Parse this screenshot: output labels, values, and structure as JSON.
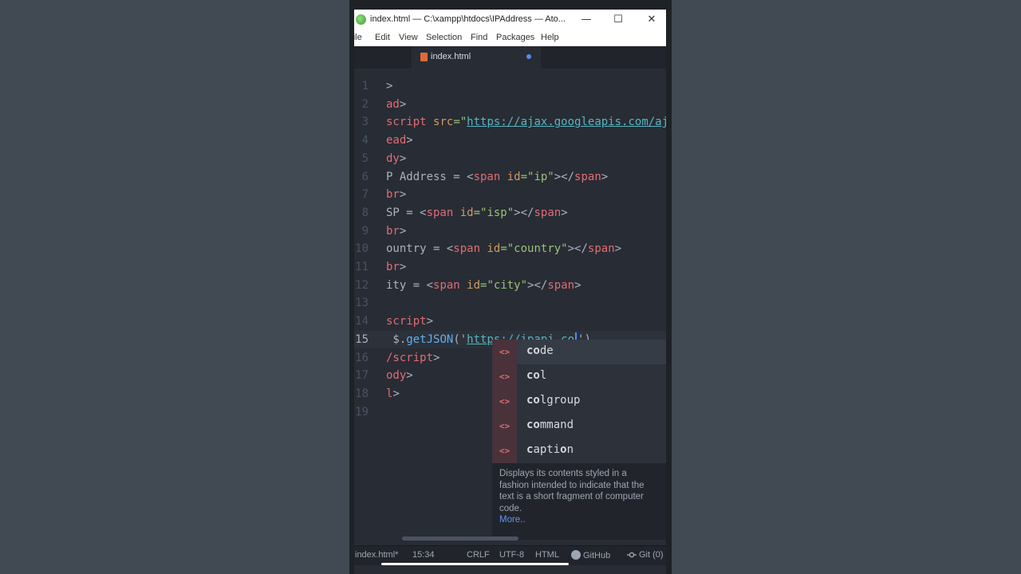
{
  "window": {
    "title": "index.html — C:\\xampp\\htdocs\\IPAddress — Ato...",
    "minimize": "—",
    "maximize": "☐",
    "close": "✕"
  },
  "menu": [
    "File",
    "Edit",
    "View",
    "Selection",
    "Find",
    "Packages",
    "Help"
  ],
  "tab": {
    "title": "index.html",
    "modified": true
  },
  "editor": {
    "lines": [
      {
        "num": "1",
        "tokens": [
          {
            "t": ">",
            "c": "t-plain"
          }
        ]
      },
      {
        "num": "2",
        "tokens": [
          {
            "t": "ad",
            "c": "t-tag"
          },
          {
            "t": ">",
            "c": "t-plain"
          }
        ]
      },
      {
        "num": "3",
        "tokens": [
          {
            "t": "script",
            "c": "t-tag"
          },
          {
            "t": " ",
            "c": "t-plain"
          },
          {
            "t": "src",
            "c": "t-attr"
          },
          {
            "t": "=\"",
            "c": "t-str"
          },
          {
            "t": "https://ajax.googleapis.com/aj",
            "c": "t-url"
          }
        ]
      },
      {
        "num": "4",
        "tokens": [
          {
            "t": "ead",
            "c": "t-tag"
          },
          {
            "t": ">",
            "c": "t-plain"
          }
        ]
      },
      {
        "num": "5",
        "tokens": [
          {
            "t": "dy",
            "c": "t-tag"
          },
          {
            "t": ">",
            "c": "t-plain"
          }
        ]
      },
      {
        "num": "6",
        "tokens": [
          {
            "t": "P Address = <",
            "c": "t-plain"
          },
          {
            "t": "span",
            "c": "t-tag"
          },
          {
            "t": " ",
            "c": "t-plain"
          },
          {
            "t": "id",
            "c": "t-attr"
          },
          {
            "t": "=\"ip\"",
            "c": "t-str"
          },
          {
            "t": "></",
            "c": "t-plain"
          },
          {
            "t": "span",
            "c": "t-tag"
          },
          {
            "t": ">",
            "c": "t-plain"
          }
        ]
      },
      {
        "num": "7",
        "tokens": [
          {
            "t": "br",
            "c": "t-tag"
          },
          {
            "t": ">",
            "c": "t-plain"
          }
        ]
      },
      {
        "num": "8",
        "tokens": [
          {
            "t": "SP = <",
            "c": "t-plain"
          },
          {
            "t": "span",
            "c": "t-tag"
          },
          {
            "t": " ",
            "c": "t-plain"
          },
          {
            "t": "id",
            "c": "t-attr"
          },
          {
            "t": "=\"isp\"",
            "c": "t-str"
          },
          {
            "t": "></",
            "c": "t-plain"
          },
          {
            "t": "span",
            "c": "t-tag"
          },
          {
            "t": ">",
            "c": "t-plain"
          }
        ]
      },
      {
        "num": "9",
        "tokens": [
          {
            "t": "br",
            "c": "t-tag"
          },
          {
            "t": ">",
            "c": "t-plain"
          }
        ]
      },
      {
        "num": "10",
        "tokens": [
          {
            "t": "ountry = <",
            "c": "t-plain"
          },
          {
            "t": "span",
            "c": "t-tag"
          },
          {
            "t": " ",
            "c": "t-plain"
          },
          {
            "t": "id",
            "c": "t-attr"
          },
          {
            "t": "=\"country\"",
            "c": "t-str"
          },
          {
            "t": "></",
            "c": "t-plain"
          },
          {
            "t": "span",
            "c": "t-tag"
          },
          {
            "t": ">",
            "c": "t-plain"
          }
        ]
      },
      {
        "num": "11",
        "tokens": [
          {
            "t": "br",
            "c": "t-tag"
          },
          {
            "t": ">",
            "c": "t-plain"
          }
        ]
      },
      {
        "num": "12",
        "tokens": [
          {
            "t": "ity = <",
            "c": "t-plain"
          },
          {
            "t": "span",
            "c": "t-tag"
          },
          {
            "t": " ",
            "c": "t-plain"
          },
          {
            "t": "id",
            "c": "t-attr"
          },
          {
            "t": "=\"city\"",
            "c": "t-str"
          },
          {
            "t": "></",
            "c": "t-plain"
          },
          {
            "t": "span",
            "c": "t-tag"
          },
          {
            "t": ">",
            "c": "t-plain"
          }
        ]
      },
      {
        "num": "13",
        "tokens": []
      },
      {
        "num": "14",
        "tokens": [
          {
            "t": "script",
            "c": "t-tag"
          },
          {
            "t": ">",
            "c": "t-plain"
          }
        ]
      },
      {
        "num": "15",
        "active": true,
        "tokens": [
          {
            "t": " $.",
            "c": "t-plain"
          },
          {
            "t": "getJSON",
            "c": "t-fn"
          },
          {
            "t": "('",
            "c": "t-plain"
          },
          {
            "t": "https://ipapi.co",
            "c": "t-url"
          },
          {
            "t": "|CURSOR|",
            "c": "cursor"
          },
          {
            "t": "')",
            "c": "t-plain"
          }
        ]
      },
      {
        "num": "16",
        "tokens": [
          {
            "t": "/script",
            "c": "t-tag"
          },
          {
            "t": ">",
            "c": "t-plain"
          }
        ]
      },
      {
        "num": "17",
        "tokens": [
          {
            "t": "ody",
            "c": "t-tag"
          },
          {
            "t": ">",
            "c": "t-plain"
          }
        ]
      },
      {
        "num": "18",
        "tokens": [
          {
            "t": "l",
            "c": "t-tag"
          },
          {
            "t": ">",
            "c": "t-plain"
          }
        ]
      },
      {
        "num": "19",
        "tokens": []
      }
    ]
  },
  "autocomplete": {
    "icon": "<>",
    "selected_index": 0,
    "items": [
      {
        "bold": "co",
        "rest": "de"
      },
      {
        "bold": "co",
        "rest": "l"
      },
      {
        "bold": "co",
        "rest": "lgroup"
      },
      {
        "bold": "co",
        "rest": "mmand"
      },
      {
        "bold": "c",
        "rest": "apti",
        "bold2": "o",
        "rest2": "n"
      }
    ],
    "description": "Displays its contents styled in a fashion intended to indicate that the text is a short fragment of computer code.",
    "more_link": "More.."
  },
  "statusbar": {
    "file": "index.html*",
    "cursor_position": "15:34",
    "line_ending": "CRLF",
    "encoding": "UTF-8",
    "grammar": "HTML",
    "github": "GitHub",
    "git": "Git (0)"
  }
}
